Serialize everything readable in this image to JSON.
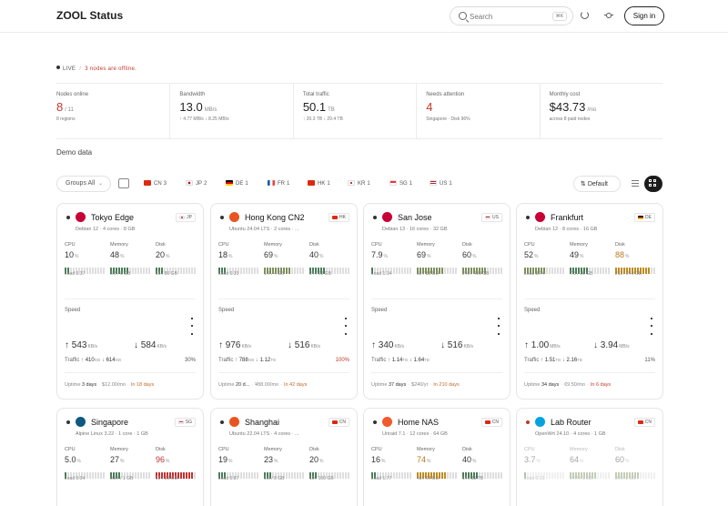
{
  "header": {
    "title": "ZOOL Status",
    "search_placeholder": "Search",
    "search_shortcut": "⌘K",
    "sign_in": "Sign in"
  },
  "banner": {
    "live": "LIVE",
    "alert": "3 nodes are offline."
  },
  "stats": [
    {
      "label": "Nodes online",
      "value": "8",
      "unit": "/ 11",
      "sub": "8 regions",
      "red": true
    },
    {
      "label": "Bandwidth",
      "value": "13.0",
      "unit": "MB/s",
      "sub": "↑ 4.77 MB/s  ↓ 8.25 MB/s",
      "red": false
    },
    {
      "label": "Total traffic",
      "value": "50.1",
      "unit": "TB",
      "sub": "↑ 20.3 TB  ↓ 29.4 TB",
      "red": false
    },
    {
      "label": "Needs attention",
      "value": "4",
      "unit": "",
      "sub": "Singapore · Disk 96%",
      "red": true
    },
    {
      "label": "Monthly cost",
      "value": "$43.73",
      "unit": "/mo",
      "sub": "across 8 paid nodes",
      "red": false
    }
  ],
  "demo_label": "Demo data",
  "filters": {
    "groups": "Groups  All",
    "chips": [
      {
        "code": "CN",
        "count": "3"
      },
      {
        "code": "JP",
        "count": "2"
      },
      {
        "code": "DE",
        "count": "1"
      },
      {
        "code": "FR",
        "count": "1"
      },
      {
        "code": "HK",
        "count": "1"
      },
      {
        "code": "KR",
        "count": "1"
      },
      {
        "code": "SG",
        "count": "1"
      },
      {
        "code": "US",
        "count": "1"
      }
    ],
    "sort": "Default"
  },
  "colors": {
    "accent": "#c0392b",
    "warn": "#b7791f",
    "ok_bar": "#4a7c59"
  },
  "labels": {
    "cpu": "CPU",
    "memory": "Memory",
    "disk": "Disk",
    "speed": "Speed",
    "traffic": "Traffic",
    "uptime": "Uptime"
  },
  "nodes": [
    {
      "name": "Tokyo Edge",
      "country": "JP",
      "sys": "Debian 12 · 4 cores · 8 GB",
      "online": true,
      "logo": "debian-icon",
      "cpu": "10",
      "cpu_frac": 0.1,
      "mem": "48",
      "mem_frac": 0.48,
      "mem_sub": "3.8 / 8 GB",
      "disk": "20",
      "disk_frac": 0.2,
      "disk_sub": "16 / 80 GB",
      "load": "Load 0.37",
      "up": "543",
      "up_unit": "KB/s",
      "down": "584",
      "down_unit": "KB/s",
      "tx": "410",
      "tx_unit": "GB",
      "rx": "614",
      "rx_unit": "GB",
      "traffic_pct": "30%",
      "traffic_alert": false,
      "uptime": "3 days",
      "cost": "$12.00/mo",
      "due": "In 18 days",
      "due_alert": false
    },
    {
      "name": "Hong Kong CN2",
      "country": "HK",
      "sys": "Ubuntu 24.04 LTS · 2 cores · ...",
      "online": true,
      "logo": "ubuntu-icon",
      "cpu": "18",
      "cpu_frac": 0.18,
      "mem": "69",
      "mem_frac": 0.69,
      "mem_sub": "1.7 / 4 GB",
      "disk": "40",
      "disk_frac": 0.4,
      "disk_sub": "24 / 60 GB",
      "load": "Load 0.33",
      "up": "976",
      "up_unit": "KB/s",
      "down": "516",
      "down_unit": "KB/s",
      "tx": "788",
      "tx_unit": "GB",
      "rx": "1.12",
      "rx_unit": "TB",
      "traffic_pct": "100%",
      "traffic_alert": true,
      "uptime": "20 d...",
      "cost": "¥88.00/mo",
      "due": "In 42 days",
      "due_alert": false
    },
    {
      "name": "San Jose",
      "country": "US",
      "sys": "Debian 13 · 16 cores · 32 GB",
      "online": true,
      "logo": "debian-icon",
      "cpu": "7.9",
      "cpu_frac": 0.08,
      "mem": "69",
      "mem_frac": 0.69,
      "mem_sub": "32 / 32 GB",
      "disk": "60",
      "disk_frac": 0.6,
      "disk_sub": "240 / 400 GB",
      "load": "Load 1.14",
      "up": "340",
      "up_unit": "KB/s",
      "down": "516",
      "down_unit": "KB/s",
      "tx": "1.14",
      "tx_unit": "TB",
      "rx": "1.64",
      "rx_unit": "TB",
      "traffic_pct": "",
      "traffic_alert": false,
      "uptime": "37 days",
      "cost": "$240/yr",
      "due": "In 210 days",
      "due_alert": false
    },
    {
      "name": "Frankfurt",
      "country": "DE",
      "sys": "Debian 12 · 8 cores · 16 GB",
      "online": true,
      "logo": "debian-icon",
      "cpu": "52",
      "cpu_frac": 0.52,
      "mem": "49",
      "mem_frac": 0.49,
      "mem_sub": "7.8 / 16 GB",
      "disk": "88",
      "disk_frac": 0.88,
      "disk_sub": "211 / 240 GB",
      "load": "Load 3.74",
      "up": "1.00",
      "up_unit": "MB/s",
      "down": "3.94",
      "down_unit": "MB/s",
      "tx": "1.51",
      "tx_unit": "TB",
      "rx": "2.16",
      "rx_unit": "TB",
      "traffic_pct": "11%",
      "traffic_alert": false,
      "uptime": "34 days",
      "cost": "€9.50/mo",
      "due": "In 6 days",
      "due_alert": true
    },
    {
      "name": "Singapore",
      "country": "SG",
      "sys": "Alpine Linux 3.22 · 1 core · 1 GB",
      "online": true,
      "logo": "alpine-icon",
      "cpu": "5.0",
      "cpu_frac": 0.05,
      "mem": "27",
      "mem_frac": 0.27,
      "mem_sub": "0.27 / 1 GB",
      "disk": "96",
      "disk_frac": 0.96,
      "disk_sub": "19 / 20 GB",
      "load": "Load 0.04"
    },
    {
      "name": "Shanghai",
      "country": "CN",
      "sys": "Ubuntu 22.04 LTS · 4 cores · ...",
      "online": true,
      "logo": "ubuntu-icon",
      "cpu": "19",
      "cpu_frac": 0.19,
      "mem": "23",
      "mem_frac": 0.23,
      "mem_sub": "1.9 / 8 GB",
      "disk": "20",
      "disk_frac": 0.2,
      "disk_sub": "10 / 100 GB",
      "load": "Load 0.87"
    },
    {
      "name": "Home NAS",
      "country": "CN",
      "sys": "Unraid 7.1 · 12 cores · 64 GB",
      "online": true,
      "logo": "unraid-icon",
      "cpu": "16",
      "cpu_frac": 0.16,
      "mem": "74",
      "mem_frac": 0.74,
      "mem_sub": "48 / 64 GB",
      "disk": "40",
      "disk_frac": 0.4,
      "disk_sub": "14 / 35 TB",
      "load": "Load 1.77"
    },
    {
      "name": "Lab Router",
      "country": "CN",
      "sys": "OpenWrt 24.10 · 4 cores · 1 GB",
      "online": false,
      "logo": "openwrt-icon",
      "cpu": "3.7",
      "cpu_frac": 0.04,
      "mem": "64",
      "mem_frac": 0.64,
      "mem_sub": "0.64 / 1 GB",
      "disk": "60",
      "disk_frac": 0.6,
      "disk_sub": "0.6 / 1 GB",
      "load": "Load 0.13"
    }
  ]
}
